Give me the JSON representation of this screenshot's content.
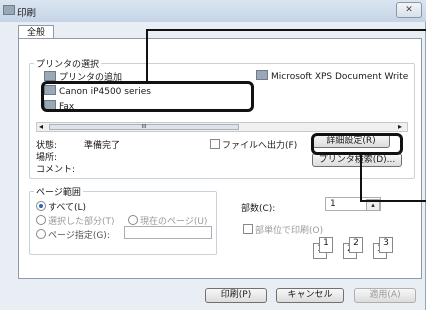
{
  "window": {
    "title": "印刷",
    "close_glyph": "✕"
  },
  "tabs": {
    "general": "全般"
  },
  "printer_select": {
    "legend": "プリンタの選択",
    "items": [
      {
        "label": "プリンタの追加"
      },
      {
        "label": "Microsoft XPS Document Write"
      },
      {
        "label": "Canon iP4500 series"
      },
      {
        "label": "Fax"
      }
    ],
    "scroll_grip": "III",
    "status_label": "状態:",
    "status_value": "準備完了",
    "location_label": "場所:",
    "comment_label": "コメント:",
    "print_to_file": "ファイルへ出力(F)",
    "preferences_button": "詳細設定(R)",
    "find_printer_button": "プリンタ検索(D)..."
  },
  "page_range": {
    "legend": "ページ範囲",
    "all": "すべて(L)",
    "selection": "選択した部分(T)",
    "current_page": "現在のページ(U)",
    "pages": "ページ指定(G):"
  },
  "copies": {
    "label": "部数(C):",
    "value": "1",
    "collate": "部単位で印刷(O)",
    "collate_pages": [
      "1",
      "1",
      "2",
      "2",
      "3",
      "3"
    ]
  },
  "footer": {
    "print_button": "印刷(P)",
    "cancel_button": "キャンセル",
    "apply_button": "適用(A)"
  }
}
